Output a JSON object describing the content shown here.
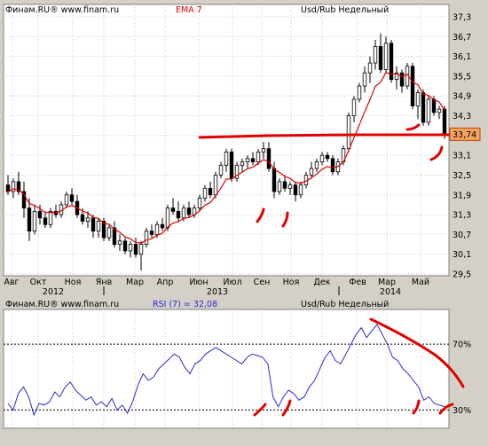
{
  "colors": {
    "background": "#d4d0c8",
    "plot_bg": "#ffffff",
    "grid": "#c8c8c8",
    "candle": "#000000",
    "ema": "#e00000",
    "rsi": "#2a2ad8",
    "markup": "#e00000",
    "price_tag": "#f4a460",
    "title_ema": "#e00000",
    "title_rsi": "#2a2ad8"
  },
  "chart_data": [
    {
      "type": "candlestick",
      "title": "Usd/Rub Недельный",
      "source": "Финам.RU®  www.finam.ru",
      "indicator_label": "EMA 7",
      "ylim": [
        29.5,
        37.3
      ],
      "yticks": [
        "37,3",
        "36,7",
        "36,1",
        "35,5",
        "34,9",
        "34,3",
        "33,7",
        "33,1",
        "32,5",
        "31,9",
        "31,3",
        "30,7",
        "30,1",
        "29,5"
      ],
      "xticks": [
        "Авг",
        "Окт",
        "Ноя",
        "Янв",
        "Мар",
        "Апр",
        "Июн",
        "Июл",
        "Сен",
        "Ноя",
        "Дек",
        "Фев",
        "Мар",
        "Май"
      ],
      "year_labels": [
        "2012",
        "2013",
        "2014"
      ],
      "current_price_label": "33,74",
      "current_price": 33.74,
      "support_level": 33.7,
      "candles": [
        {
          "o": 32.2,
          "h": 32.5,
          "l": 31.9,
          "c": 32.0
        },
        {
          "o": 32.0,
          "h": 32.4,
          "l": 31.8,
          "c": 32.3
        },
        {
          "o": 32.3,
          "h": 32.6,
          "l": 31.9,
          "c": 32.0
        },
        {
          "o": 32.0,
          "h": 32.3,
          "l": 31.2,
          "c": 31.5
        },
        {
          "o": 31.5,
          "h": 31.8,
          "l": 30.5,
          "c": 30.8
        },
        {
          "o": 30.8,
          "h": 31.6,
          "l": 30.7,
          "c": 31.4
        },
        {
          "o": 31.4,
          "h": 31.6,
          "l": 31.0,
          "c": 31.2
        },
        {
          "o": 31.2,
          "h": 31.4,
          "l": 30.9,
          "c": 31.0
        },
        {
          "o": 31.0,
          "h": 31.5,
          "l": 30.9,
          "c": 31.4
        },
        {
          "o": 31.4,
          "h": 31.6,
          "l": 31.2,
          "c": 31.3
        },
        {
          "o": 31.3,
          "h": 31.7,
          "l": 31.2,
          "c": 31.6
        },
        {
          "o": 31.6,
          "h": 32.0,
          "l": 31.5,
          "c": 31.9
        },
        {
          "o": 31.9,
          "h": 32.1,
          "l": 31.6,
          "c": 31.7
        },
        {
          "o": 31.7,
          "h": 31.9,
          "l": 31.2,
          "c": 31.3
        },
        {
          "o": 31.3,
          "h": 31.5,
          "l": 31.0,
          "c": 31.1
        },
        {
          "o": 31.1,
          "h": 31.4,
          "l": 30.9,
          "c": 31.2
        },
        {
          "o": 31.2,
          "h": 31.3,
          "l": 30.6,
          "c": 30.8
        },
        {
          "o": 30.8,
          "h": 31.2,
          "l": 30.6,
          "c": 31.1
        },
        {
          "o": 31.1,
          "h": 31.2,
          "l": 30.5,
          "c": 30.6
        },
        {
          "o": 30.6,
          "h": 31.0,
          "l": 30.5,
          "c": 30.9
        },
        {
          "o": 30.9,
          "h": 31.1,
          "l": 30.3,
          "c": 30.4
        },
        {
          "o": 30.4,
          "h": 30.7,
          "l": 30.2,
          "c": 30.5
        },
        {
          "o": 30.5,
          "h": 30.6,
          "l": 30.1,
          "c": 30.2
        },
        {
          "o": 30.2,
          "h": 30.5,
          "l": 30.0,
          "c": 30.4
        },
        {
          "o": 30.4,
          "h": 30.6,
          "l": 30.0,
          "c": 30.1
        },
        {
          "o": 30.1,
          "h": 30.5,
          "l": 29.6,
          "c": 30.4
        },
        {
          "o": 30.4,
          "h": 30.9,
          "l": 30.3,
          "c": 30.8
        },
        {
          "o": 30.8,
          "h": 31.0,
          "l": 30.6,
          "c": 30.7
        },
        {
          "o": 30.7,
          "h": 31.1,
          "l": 30.6,
          "c": 31.0
        },
        {
          "o": 31.0,
          "h": 31.2,
          "l": 30.8,
          "c": 30.9
        },
        {
          "o": 30.9,
          "h": 31.6,
          "l": 30.8,
          "c": 31.5
        },
        {
          "o": 31.5,
          "h": 31.8,
          "l": 31.3,
          "c": 31.4
        },
        {
          "o": 31.4,
          "h": 31.7,
          "l": 31.1,
          "c": 31.2
        },
        {
          "o": 31.2,
          "h": 31.6,
          "l": 31.1,
          "c": 31.5
        },
        {
          "o": 31.5,
          "h": 31.7,
          "l": 31.2,
          "c": 31.3
        },
        {
          "o": 31.3,
          "h": 31.6,
          "l": 31.2,
          "c": 31.5
        },
        {
          "o": 31.5,
          "h": 31.9,
          "l": 31.4,
          "c": 31.8
        },
        {
          "o": 31.8,
          "h": 32.2,
          "l": 31.7,
          "c": 32.1
        },
        {
          "o": 32.1,
          "h": 32.3,
          "l": 31.8,
          "c": 31.9
        },
        {
          "o": 31.9,
          "h": 32.6,
          "l": 31.8,
          "c": 32.5
        },
        {
          "o": 32.5,
          "h": 32.9,
          "l": 32.4,
          "c": 32.8
        },
        {
          "o": 32.8,
          "h": 33.3,
          "l": 32.6,
          "c": 33.2
        },
        {
          "o": 33.2,
          "h": 33.3,
          "l": 32.3,
          "c": 32.4
        },
        {
          "o": 32.4,
          "h": 32.9,
          "l": 32.3,
          "c": 32.8
        },
        {
          "o": 32.8,
          "h": 33.0,
          "l": 32.6,
          "c": 32.9
        },
        {
          "o": 32.9,
          "h": 33.1,
          "l": 32.7,
          "c": 33.0
        },
        {
          "o": 33.0,
          "h": 33.2,
          "l": 32.8,
          "c": 32.9
        },
        {
          "o": 32.9,
          "h": 33.3,
          "l": 32.8,
          "c": 33.2
        },
        {
          "o": 33.2,
          "h": 33.5,
          "l": 33.0,
          "c": 33.3
        },
        {
          "o": 33.3,
          "h": 33.5,
          "l": 32.6,
          "c": 32.7
        },
        {
          "o": 32.7,
          "h": 32.9,
          "l": 31.8,
          "c": 32.0
        },
        {
          "o": 32.0,
          "h": 32.4,
          "l": 31.9,
          "c": 32.3
        },
        {
          "o": 32.3,
          "h": 32.5,
          "l": 32.0,
          "c": 32.1
        },
        {
          "o": 32.1,
          "h": 32.3,
          "l": 31.9,
          "c": 32.2
        },
        {
          "o": 32.2,
          "h": 32.3,
          "l": 31.7,
          "c": 31.9
        },
        {
          "o": 31.9,
          "h": 32.3,
          "l": 31.8,
          "c": 32.2
        },
        {
          "o": 32.2,
          "h": 32.6,
          "l": 32.1,
          "c": 32.5
        },
        {
          "o": 32.5,
          "h": 32.9,
          "l": 32.4,
          "c": 32.7
        },
        {
          "o": 32.7,
          "h": 33.0,
          "l": 32.6,
          "c": 32.9
        },
        {
          "o": 32.9,
          "h": 33.2,
          "l": 32.8,
          "c": 33.1
        },
        {
          "o": 33.1,
          "h": 33.2,
          "l": 32.9,
          "c": 33.0
        },
        {
          "o": 33.0,
          "h": 33.1,
          "l": 32.5,
          "c": 32.6
        },
        {
          "o": 32.6,
          "h": 33.0,
          "l": 32.5,
          "c": 32.9
        },
        {
          "o": 32.9,
          "h": 33.4,
          "l": 32.8,
          "c": 33.3
        },
        {
          "o": 33.3,
          "h": 34.4,
          "l": 33.2,
          "c": 34.3
        },
        {
          "o": 34.3,
          "h": 34.9,
          "l": 34.1,
          "c": 34.8
        },
        {
          "o": 34.8,
          "h": 35.3,
          "l": 34.7,
          "c": 35.2
        },
        {
          "o": 35.2,
          "h": 35.8,
          "l": 35.0,
          "c": 35.6
        },
        {
          "o": 35.6,
          "h": 36.1,
          "l": 35.3,
          "c": 35.9
        },
        {
          "o": 35.9,
          "h": 36.6,
          "l": 35.7,
          "c": 36.4
        },
        {
          "o": 36.4,
          "h": 36.8,
          "l": 35.6,
          "c": 35.7
        },
        {
          "o": 35.7,
          "h": 36.7,
          "l": 35.6,
          "c": 36.5
        },
        {
          "o": 36.5,
          "h": 36.6,
          "l": 35.3,
          "c": 35.4
        },
        {
          "o": 35.4,
          "h": 35.8,
          "l": 35.1,
          "c": 35.6
        },
        {
          "o": 35.6,
          "h": 35.7,
          "l": 35.0,
          "c": 35.2
        },
        {
          "o": 35.2,
          "h": 35.9,
          "l": 35.1,
          "c": 35.8
        },
        {
          "o": 35.8,
          "h": 35.9,
          "l": 34.5,
          "c": 34.6
        },
        {
          "o": 34.6,
          "h": 35.1,
          "l": 34.2,
          "c": 35.0
        },
        {
          "o": 35.0,
          "h": 35.1,
          "l": 34.0,
          "c": 34.1
        },
        {
          "o": 34.1,
          "h": 34.9,
          "l": 34.0,
          "c": 34.8
        },
        {
          "o": 34.8,
          "h": 34.9,
          "l": 34.3,
          "c": 34.4
        },
        {
          "o": 34.4,
          "h": 34.6,
          "l": 34.2,
          "c": 34.5
        },
        {
          "o": 34.5,
          "h": 34.6,
          "l": 33.6,
          "c": 33.74
        }
      ]
    },
    {
      "type": "line",
      "title": "Usd/Rub Недельный",
      "source": "Финам.RU®  www.finam.ru",
      "series_label": "RSI (7) = 32,08",
      "ylim": [
        20,
        90
      ],
      "levels": [
        {
          "value": 70,
          "label": "70%"
        },
        {
          "value": 30,
          "label": "30%"
        }
      ],
      "values": [
        34,
        30,
        40,
        44,
        38,
        27,
        34,
        33,
        35,
        41,
        38,
        44,
        47,
        42,
        39,
        36,
        38,
        33,
        35,
        32,
        37,
        30,
        33,
        28,
        35,
        45,
        52,
        48,
        50,
        55,
        58,
        61,
        64,
        62,
        56,
        52,
        58,
        60,
        64,
        66,
        68,
        66,
        64,
        62,
        60,
        58,
        62,
        64,
        63,
        62,
        58,
        38,
        32,
        38,
        42,
        40,
        36,
        38,
        44,
        48,
        55,
        62,
        66,
        60,
        58,
        64,
        70,
        76,
        80,
        74,
        78,
        82,
        76,
        70,
        62,
        60,
        55,
        52,
        48,
        44,
        36,
        38,
        34,
        33,
        32.08
      ]
    }
  ]
}
